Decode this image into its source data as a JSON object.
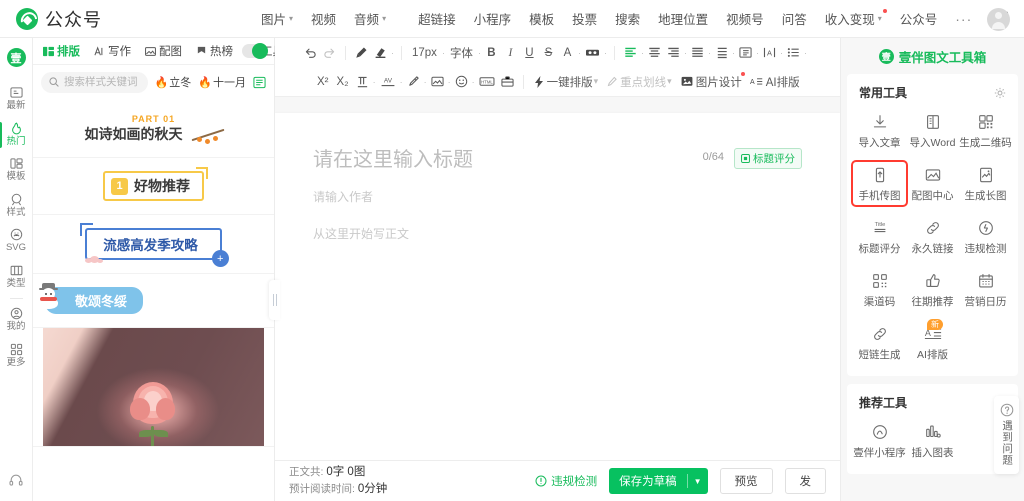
{
  "topbar": {
    "brand": "公众号",
    "nav_group_1": [
      {
        "label": "图片",
        "caret": true
      },
      {
        "label": "视频",
        "caret": false
      },
      {
        "label": "音频",
        "caret": true
      }
    ],
    "nav_group_2": [
      {
        "label": "超链接",
        "caret": false
      },
      {
        "label": "小程序",
        "caret": false
      },
      {
        "label": "模板",
        "caret": false
      },
      {
        "label": "投票",
        "caret": false
      },
      {
        "label": "搜索",
        "caret": false
      },
      {
        "label": "地理位置",
        "caret": false
      },
      {
        "label": "视频号",
        "caret": false
      },
      {
        "label": "问答",
        "caret": false
      },
      {
        "label": "收入变现",
        "caret": true,
        "dot": true
      },
      {
        "label": "公众号",
        "caret": false
      }
    ],
    "more": "···",
    "doc_icon": "document-export-icon",
    "avatar": "user-avatar"
  },
  "rail": {
    "logo": "壹",
    "items": [
      {
        "label": "最新",
        "icon": "feed-icon",
        "active": false
      },
      {
        "label": "热门",
        "icon": "fire-icon",
        "active": true
      },
      {
        "label": "模板",
        "icon": "template-icon",
        "active": false
      },
      {
        "label": "样式",
        "icon": "style-icon",
        "active": false
      },
      {
        "label": "SVG",
        "icon": "svg-icon",
        "active": false
      },
      {
        "label": "类型",
        "icon": "category-icon",
        "active": false
      },
      {
        "label": "我的",
        "icon": "user-circle-icon",
        "active": false
      },
      {
        "label": "更多",
        "icon": "grid-icon",
        "active": false
      }
    ],
    "bottom_icon": "headset-support-icon"
  },
  "left_panel": {
    "tabs": [
      {
        "label": "排版",
        "icon": "layout-icon",
        "active": true
      },
      {
        "label": "写作",
        "icon": "ai-write-icon",
        "active": false
      },
      {
        "label": "配图",
        "icon": "image-icon",
        "active": false
      },
      {
        "label": "热榜",
        "icon": "flag-icon",
        "active": false
      },
      {
        "label": "工具",
        "icon": "tool-icon",
        "active": false
      }
    ],
    "toggle_on": true,
    "search_placeholder": "搜索样式关键词",
    "chips": [
      {
        "label": "立冬",
        "icon": "flame-icon"
      },
      {
        "label": "十一月",
        "icon": "flame-icon"
      }
    ],
    "list_icon": "list-view-icon",
    "cards": [
      {
        "name": "card-autumn",
        "part": "PART 01",
        "title": "如诗如画的秋天"
      },
      {
        "name": "card-goods",
        "num": "1",
        "title": "好物推荐"
      },
      {
        "name": "card-flu",
        "title": "流感高发季攻略",
        "plus": "+"
      },
      {
        "name": "card-winter",
        "title": "敬颂冬绥"
      },
      {
        "name": "card-photo",
        "title": ""
      }
    ]
  },
  "editor": {
    "toolbar_row1": [
      {
        "name": "undo",
        "glyph": "↺",
        "type": "icon"
      },
      {
        "name": "redo",
        "glyph": "↻",
        "type": "icon"
      },
      {
        "name": "sep"
      },
      {
        "name": "format-brush",
        "glyph": "brush",
        "type": "svg"
      },
      {
        "name": "clear-format",
        "glyph": "eraser",
        "type": "svg",
        "caret": true
      },
      {
        "name": "sep"
      },
      {
        "name": "font-size",
        "label": "17px",
        "type": "text",
        "caret": true
      },
      {
        "name": "font-family",
        "label": "字体",
        "type": "text",
        "caret": true
      },
      {
        "name": "bold",
        "label": "B",
        "type": "text"
      },
      {
        "name": "italic",
        "label": "I",
        "type": "text"
      },
      {
        "name": "underline",
        "label": "U",
        "type": "text"
      },
      {
        "name": "strikethrough",
        "label": "S",
        "type": "text"
      },
      {
        "name": "font-color",
        "label": "A",
        "type": "text",
        "caret": true
      },
      {
        "name": "highlight",
        "glyph": "marker",
        "type": "svg",
        "caret": true
      },
      {
        "name": "sep"
      },
      {
        "name": "align-left",
        "glyph": "align-left",
        "type": "svg",
        "caret": true,
        "green": true
      },
      {
        "name": "align-center",
        "glyph": "align-center",
        "type": "svg",
        "caret": true
      },
      {
        "name": "align-right",
        "glyph": "align-right",
        "type": "svg",
        "caret": true
      },
      {
        "name": "align-justify",
        "glyph": "align-justify",
        "type": "svg",
        "caret": true
      },
      {
        "name": "line-height",
        "glyph": "line-height",
        "type": "svg",
        "caret": true
      },
      {
        "name": "indent",
        "glyph": "indent",
        "type": "svg",
        "caret": true
      },
      {
        "name": "letter-spacing",
        "glyph": "letter-spacing",
        "type": "svg",
        "caret": true
      },
      {
        "name": "list",
        "glyph": "bullet-list",
        "type": "svg",
        "caret": true
      }
    ],
    "toolbar_row2": [
      {
        "name": "superscript",
        "label": "X²",
        "type": "text"
      },
      {
        "name": "subscript",
        "label": "X₂",
        "type": "text"
      },
      {
        "name": "paragraph-format",
        "glyph": "para",
        "type": "svg",
        "caret": true
      },
      {
        "name": "kerning",
        "label": "AV",
        "type": "text",
        "caret": true
      },
      {
        "name": "eyedropper",
        "glyph": "pen",
        "type": "svg",
        "caret": true
      },
      {
        "name": "insert-image",
        "glyph": "picture",
        "type": "svg",
        "caret": true
      },
      {
        "name": "emoji",
        "glyph": "smile",
        "type": "svg",
        "caret": true
      },
      {
        "name": "html-source",
        "label": "HTML",
        "type": "badge"
      },
      {
        "name": "toolbox",
        "glyph": "toolbox",
        "type": "svg"
      },
      {
        "name": "sep"
      },
      {
        "name": "one-click-layout",
        "label": "一键排版",
        "type": "text",
        "icon": "bolt-icon",
        "caret": true
      },
      {
        "name": "key-underline",
        "label": "重点划线",
        "type": "text",
        "icon": "pen-icon",
        "caret": true,
        "dim": true
      },
      {
        "name": "image-design",
        "label": "图片设计",
        "type": "text",
        "icon": "image-design-icon",
        "dot": true
      },
      {
        "name": "ai-layout",
        "label": "AI排版",
        "type": "text",
        "icon": "ai-icon"
      }
    ],
    "doc": {
      "title_placeholder": "请在这里输入标题",
      "title_count": "0/64",
      "title_score_label": "标题评分",
      "author_placeholder": "请输入作者",
      "body_placeholder": "从这里开始写正文"
    },
    "status": {
      "count_prefix": "正文共:",
      "count_value": "0字 0图",
      "read_prefix": "预计阅读时间:",
      "read_value": "0分钟",
      "violation_check": "违规检测",
      "save_draft": "保存为草稿",
      "preview": "预览",
      "publish": "发"
    }
  },
  "right_panel": {
    "header": "壹伴图文工具箱",
    "header_logo": "壹",
    "sections": [
      {
        "title": "常用工具",
        "gear_icon": "gear-icon",
        "tools": [
          {
            "label": "导入文章",
            "icon": "download-icon",
            "selected": false
          },
          {
            "label": "导入Word",
            "icon": "word-file-icon",
            "selected": false
          },
          {
            "label": "生成二维码",
            "icon": "qrcode-icon",
            "selected": false
          },
          {
            "label": "手机传图",
            "icon": "phone-upload-icon",
            "selected": true
          },
          {
            "label": "配图中心",
            "icon": "image-center-icon",
            "selected": false
          },
          {
            "label": "生成长图",
            "icon": "long-image-icon",
            "selected": false
          },
          {
            "label": "标题评分",
            "icon": "title-score-icon",
            "selected": false
          },
          {
            "label": "永久链接",
            "icon": "link-icon",
            "selected": false
          },
          {
            "label": "违规检测",
            "icon": "shield-check-icon",
            "selected": false
          },
          {
            "label": "渠道码",
            "icon": "channel-qr-icon",
            "selected": false
          },
          {
            "label": "往期推荐",
            "icon": "thumbs-up-icon",
            "selected": false
          },
          {
            "label": "营销日历",
            "icon": "calendar-icon",
            "selected": false
          },
          {
            "label": "短链生成",
            "icon": "short-link-icon",
            "selected": false
          },
          {
            "label": "AI排版",
            "icon": "ai-layout-icon",
            "selected": false,
            "badge": "新"
          }
        ]
      },
      {
        "title": "推荐工具",
        "tools": [
          {
            "label": "壹伴小程序",
            "icon": "miniprogram-icon",
            "selected": false
          },
          {
            "label": "插入图表",
            "icon": "chart-icon",
            "selected": false
          }
        ]
      }
    ],
    "help_tab": {
      "icon": "question-icon",
      "label": "遇到问题"
    }
  }
}
